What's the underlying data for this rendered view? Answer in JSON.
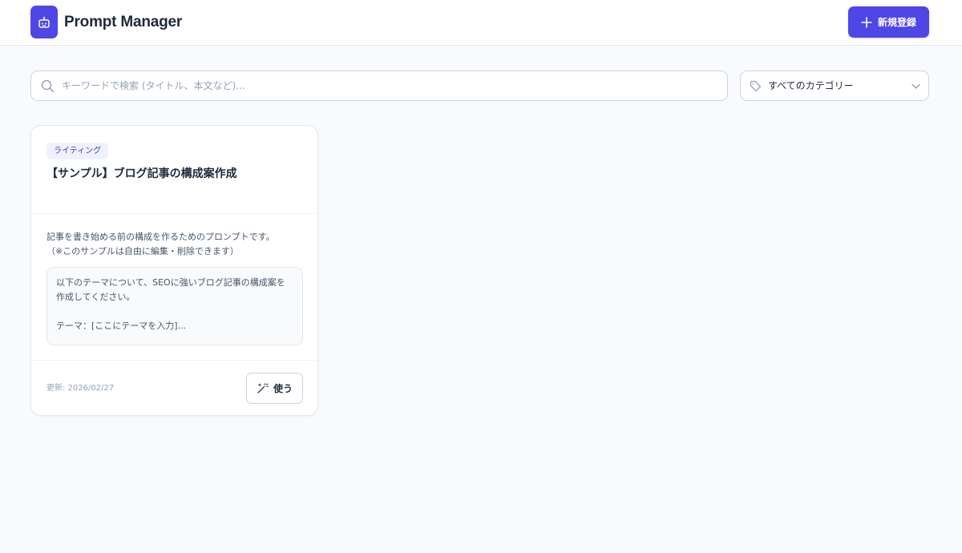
{
  "app": {
    "title": "Prompt Manager",
    "brand_color": "#4f46e5"
  },
  "header": {
    "logo_icon": "robot-icon",
    "new_button": {
      "label": "新規登録",
      "icon": "plus-icon"
    }
  },
  "filters": {
    "search": {
      "placeholder": "キーワードで検索 (タイトル、本文など)...",
      "value": "",
      "icon": "search-icon"
    },
    "category": {
      "selected": "すべてのカテゴリー",
      "icon": "tag-icon",
      "dropdown_icon": "chevron-down-icon"
    }
  },
  "prompts": [
    {
      "category": "ライティング",
      "title": "【サンプル】ブログ記事の構成案作成",
      "description": "記事を書き始める前の構成を作るためのプロンプトです。\n（※このサンプルは自由に編集・削除できます）",
      "preview": "以下のテーマについて、SEOに強いブログ記事の構成案を作成してください。\n\nテーマ：[ここにテーマを入力]...",
      "updated": "更新: 2026/02/27",
      "use_button": {
        "label": "使う",
        "icon": "magic-wand-icon"
      }
    }
  ]
}
